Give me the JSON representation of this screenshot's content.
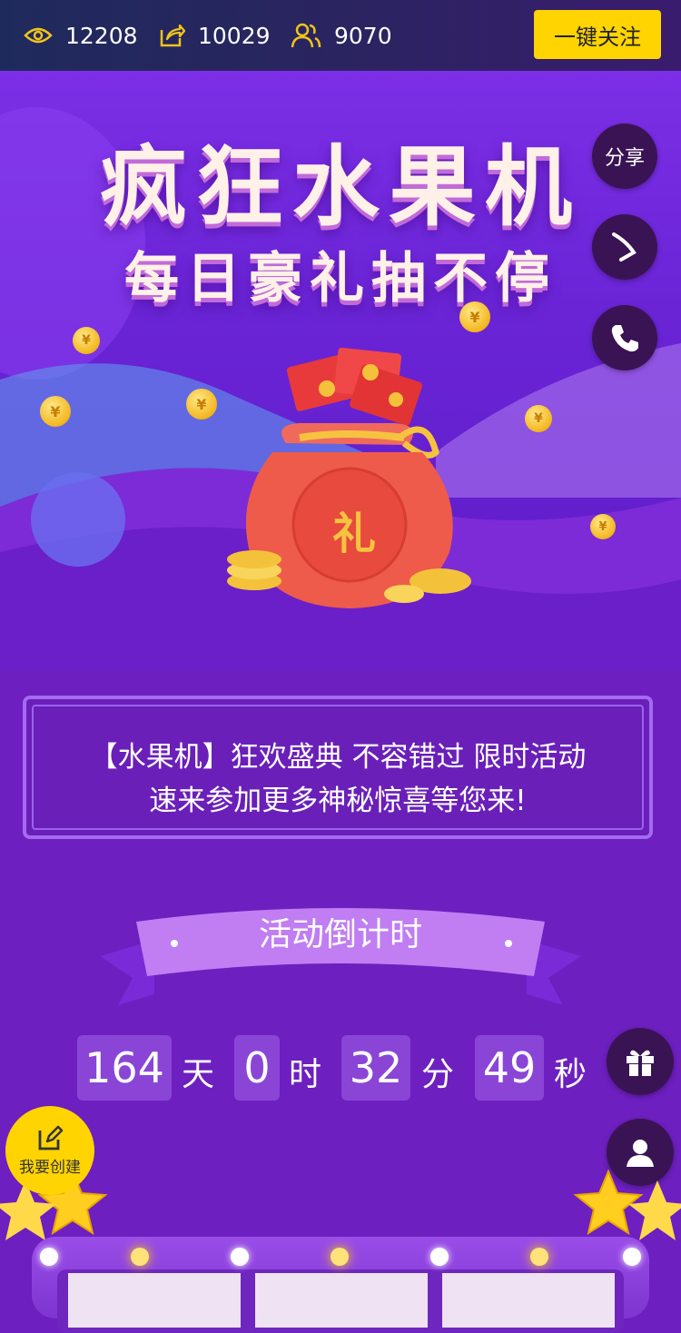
{
  "stats": {
    "views": "12208",
    "shares": "10029",
    "participants": "9070",
    "follow_label": "一键关注"
  },
  "hero": {
    "title": "疯狂水果机",
    "subtitle": "每日豪礼抽不停",
    "bag_label": "礼",
    "coin_symbol": "¥"
  },
  "side": {
    "share_label": "分享"
  },
  "notice": {
    "line1": "【水果机】狂欢盛典 不容错过 限时活动",
    "line2": "速来参加更多神秘惊喜等您来!"
  },
  "countdown": {
    "title": "活动倒计时",
    "days": "164",
    "days_unit": "天",
    "hours": "0",
    "hours_unit": "时",
    "minutes": "32",
    "minutes_unit": "分",
    "seconds": "49",
    "seconds_unit": "秒"
  },
  "create": {
    "label": "我要创建"
  },
  "colors": {
    "accent_yellow": "#ffd400",
    "bg_purple": "#6d1fc0",
    "topbar": "#1f2a5c"
  }
}
